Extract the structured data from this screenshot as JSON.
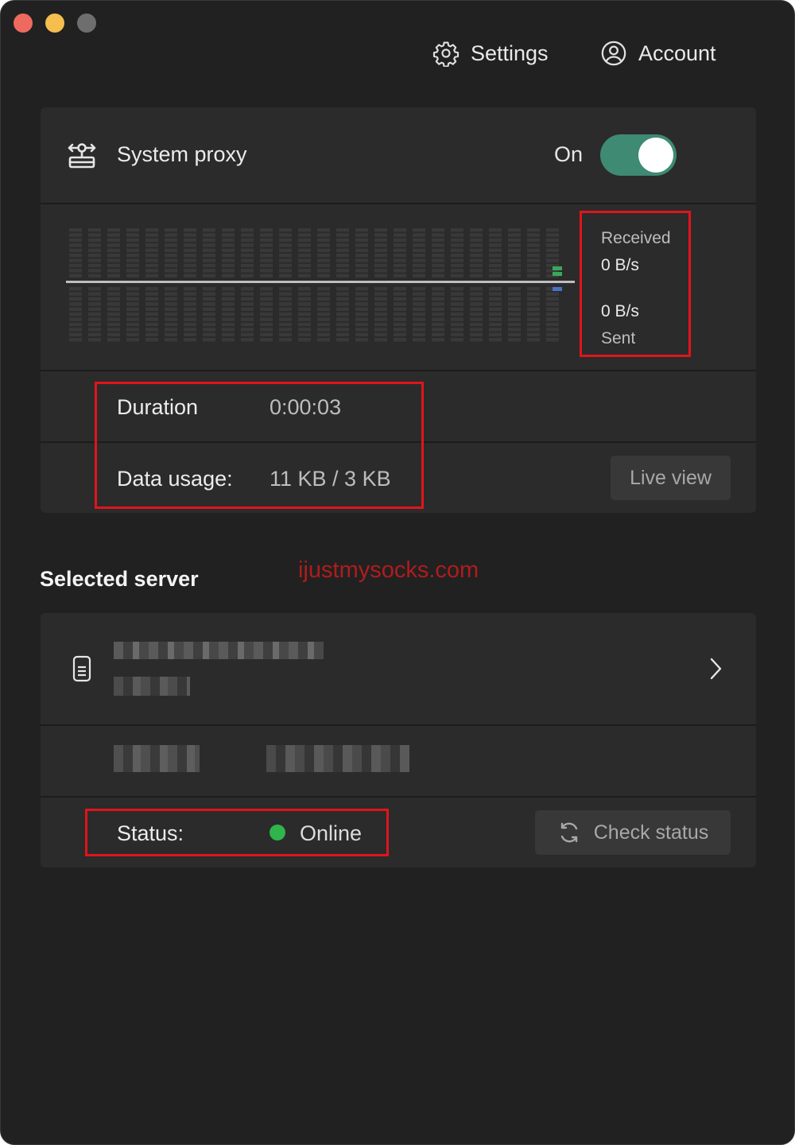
{
  "window": {
    "controls": [
      "close",
      "minimize",
      "zoom"
    ]
  },
  "nav": {
    "settings": {
      "label": "Settings",
      "icon": "gear-icon"
    },
    "account": {
      "label": "Account",
      "icon": "user-circle-icon"
    }
  },
  "proxy": {
    "icon": "proxy-arrows-icon",
    "label": "System proxy",
    "state_label": "On",
    "enabled": true,
    "toggle_color": "#3e8a73"
  },
  "traffic": {
    "received_label": "Received",
    "received_value": "0 B/s",
    "sent_value": "0 B/s",
    "sent_label": "Sent",
    "received_color": "#3aa85a",
    "sent_color": "#4a72c4"
  },
  "session": {
    "duration_label": "Duration",
    "duration_value": "0:00:03",
    "usage_label": "Data usage:",
    "usage_value": "11 KB / 3 KB",
    "live_view_label": "Live view"
  },
  "server": {
    "section_title": "Selected server",
    "watermark": "ijustmysocks.com",
    "device_icon": "phone-icon",
    "status_label": "Status:",
    "status_value": "Online",
    "status_color": "#2fb54b",
    "check_status_label": "Check status",
    "check_status_icon": "refresh-icon"
  },
  "accent_colors": {
    "highlight_box": "#e1141b"
  }
}
